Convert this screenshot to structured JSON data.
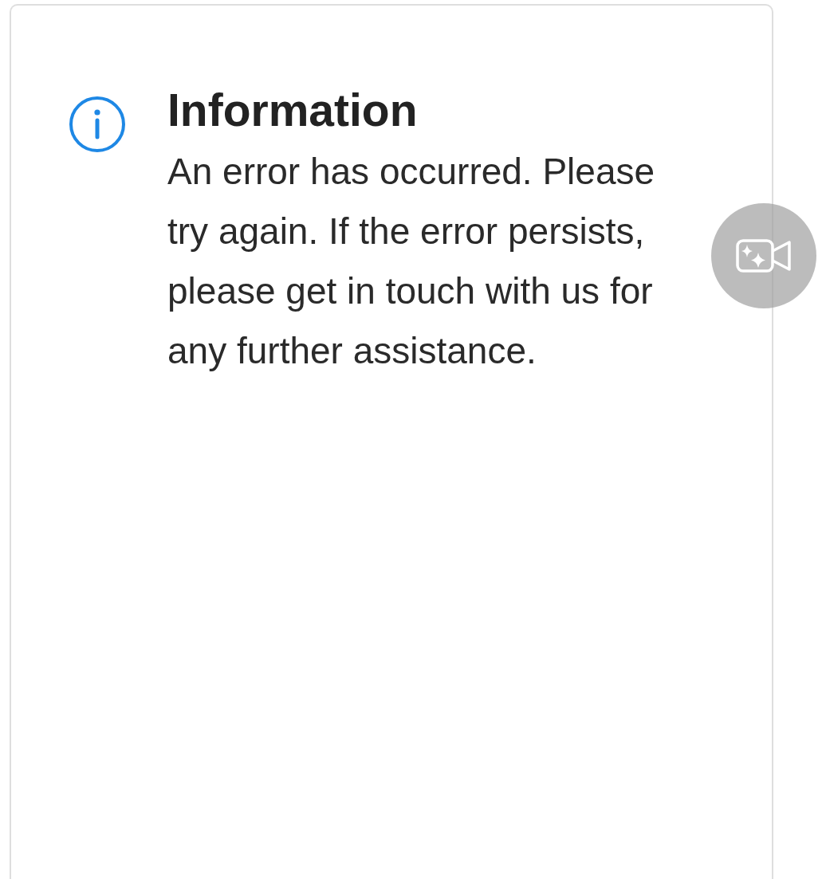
{
  "card": {
    "title": "Information",
    "message": "An error has occurred. Please try again. If the error persists, please get in touch with us for any further assistance."
  }
}
